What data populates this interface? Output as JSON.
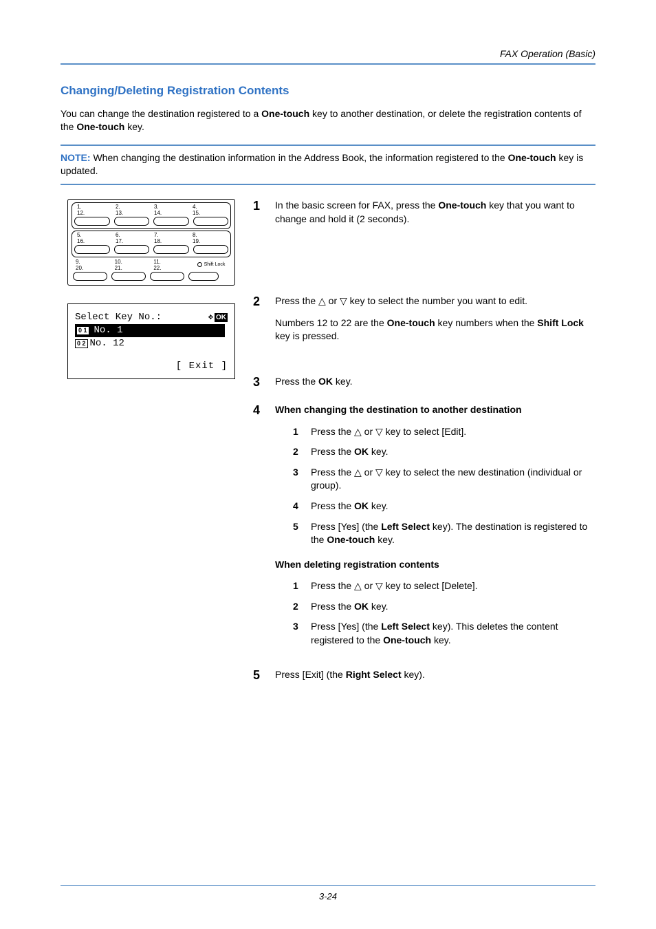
{
  "header": {
    "section": "FAX Operation (Basic)"
  },
  "title": "Changing/Deleting Registration Contents",
  "intro": {
    "pre": "You can change the destination registered to a ",
    "k1": "One-touch",
    "mid": " key to another destination, or delete the registration contents of the ",
    "k2": "One-touch",
    "post": " key."
  },
  "note": {
    "label": "NOTE:",
    "pre": " When changing the destination information in the Address Book, the information registered to the ",
    "k1": "One-touch",
    "post": " key is updated."
  },
  "keypad": {
    "row1top": [
      "1.",
      "2.",
      "3.",
      "4."
    ],
    "row1bot": [
      "12.",
      "13.",
      "14.",
      "15."
    ],
    "row2top": [
      "5.",
      "6.",
      "7.",
      "8."
    ],
    "row2bot": [
      "16.",
      "17.",
      "18.",
      "19."
    ],
    "row3top": [
      "9.",
      "10.",
      "11."
    ],
    "row3bot": [
      "20.",
      "21.",
      "22."
    ],
    "shift": "Shift Lock"
  },
  "lcd": {
    "title": "Select Key No.:",
    "line1_badge": "0 1",
    "line1_text": "No. 1",
    "line2_badge": "0 2",
    "line2_text": "No. 12",
    "exit": "[  Exit  ]"
  },
  "steps": {
    "s1": {
      "n": "1",
      "pre": "In the basic screen for FAX, press the ",
      "k": "One-touch",
      "post": " key that you want to change and hold it (2 seconds)."
    },
    "s2": {
      "n": "2",
      "line1": "Press the △ or ▽ key to select the number you want to edit.",
      "line2_pre": "Numbers 12 to 22 are the ",
      "line2_k1": "One-touch",
      "line2_mid": " key numbers when the ",
      "line2_k2": "Shift Lock",
      "line2_post": " key is pressed."
    },
    "s3": {
      "n": "3",
      "pre": "Press the ",
      "k": "OK",
      "post": " key."
    },
    "s4": {
      "n": "4",
      "headA": "When changing the destination to another destination",
      "a1": "Press the △ or ▽ key to select [Edit].",
      "a2_pre": "Press the ",
      "a2_k": "OK",
      "a2_post": " key.",
      "a3": "Press the △ or ▽ key to select the new destination (individual or group).",
      "a4_pre": "Press the ",
      "a4_k": "OK",
      "a4_post": " key.",
      "a5_pre": "Press [Yes] (the ",
      "a5_k1": "Left Select",
      "a5_mid": " key). The destination is registered to the ",
      "a5_k2": "One-touch",
      "a5_post": " key.",
      "headB": "When deleting registration contents",
      "b1": "Press the △ or ▽ key to select [Delete].",
      "b2_pre": "Press the ",
      "b2_k": "OK",
      "b2_post": " key.",
      "b3_pre": "Press [Yes] (the ",
      "b3_k1": "Left Select",
      "b3_mid": " key). This deletes the content registered to the ",
      "b3_k2": "One-touch",
      "b3_post": " key."
    },
    "s5": {
      "n": "5",
      "pre": "Press [Exit] (the ",
      "k": "Right Select",
      "post": " key)."
    }
  },
  "footer": "3-24"
}
